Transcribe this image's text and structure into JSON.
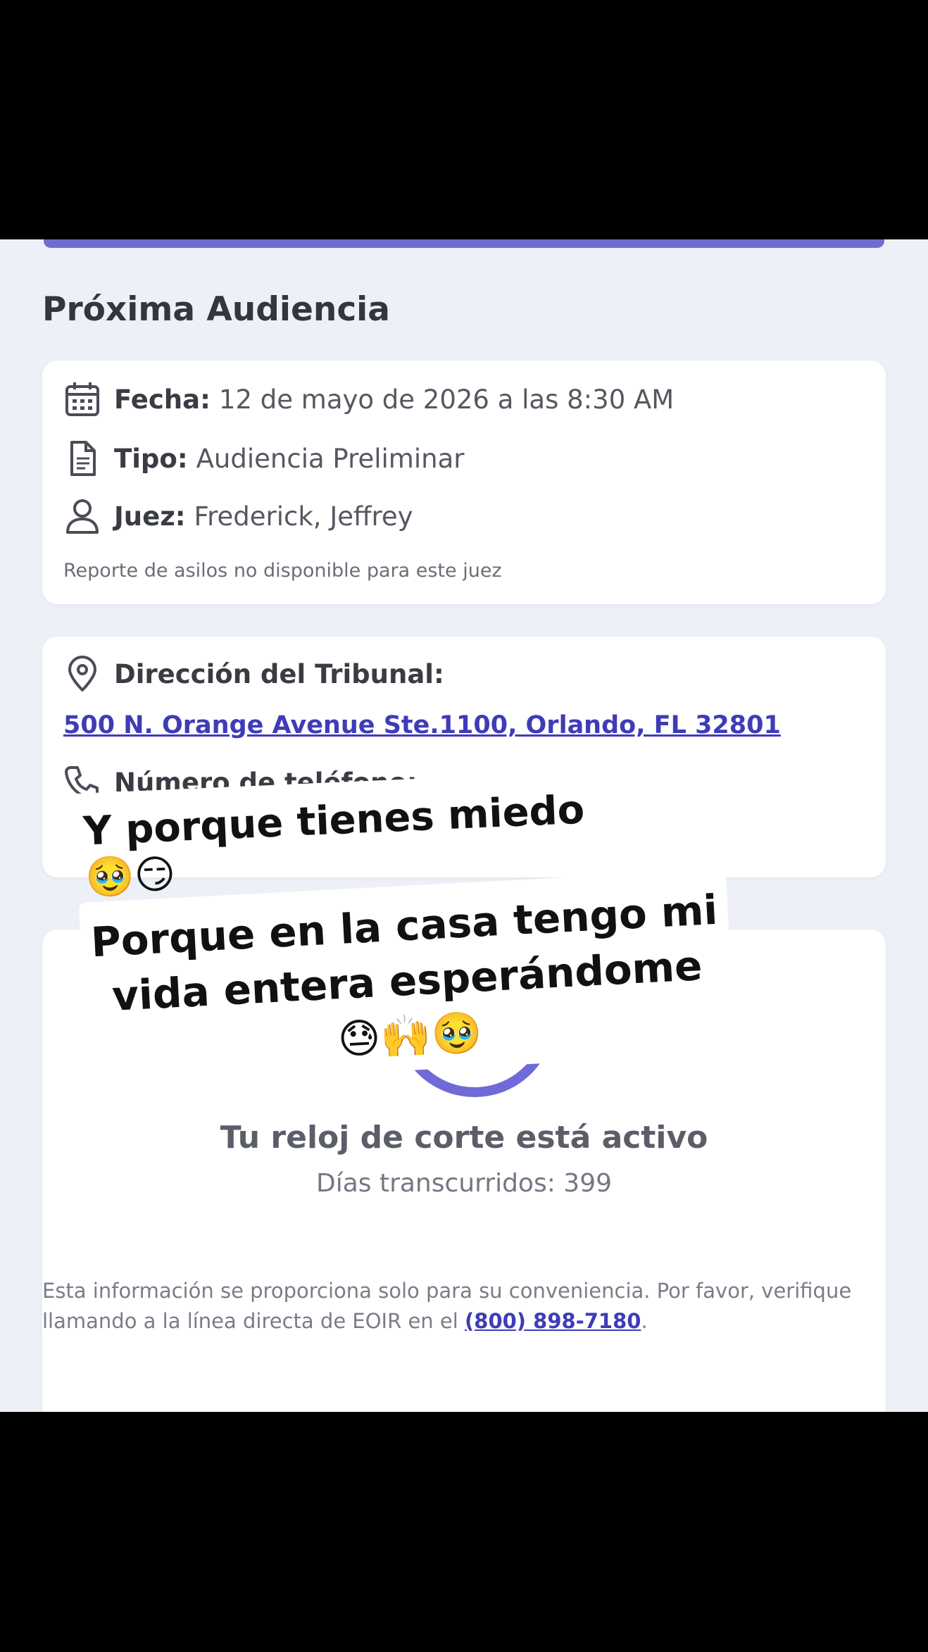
{
  "hearing": {
    "section_title": "Próxima Audiencia",
    "date_label": "Fecha:",
    "date_value": "12 de mayo de 2026 a las 8:30 AM",
    "type_label": "Tipo:",
    "type_value": "Audiencia Preliminar",
    "judge_label": "Juez:",
    "judge_value": "Frederick, Jeffrey",
    "note": "Reporte de asilos no disponible para este juez"
  },
  "court": {
    "address_label": "Dirección del Tribunal:",
    "address_link": "500 N. Orange Avenue Ste.1100, Orlando, FL 32801",
    "phone_label": "Número de teléfono:"
  },
  "captions": {
    "first": "Y porque tienes miedo 🥹😏",
    "second": "Porque en la casa tengo mi vida entera esperándome 😓🙌🥹"
  },
  "clock": {
    "title": "Tu reloj de corte está activo",
    "days_label": "Días transcurridos:",
    "days_value": "399"
  },
  "disclaimer": {
    "text": "Esta información se proporciona solo para su conveniencia. Por favor, verifique llamando a la línea directa de EOIR en el",
    "phone_link": "(800) 898-7180",
    "end": "."
  },
  "colors": {
    "accent": "#6f6ccf",
    "link": "#3f3cb8",
    "background": "#eef0f8"
  }
}
